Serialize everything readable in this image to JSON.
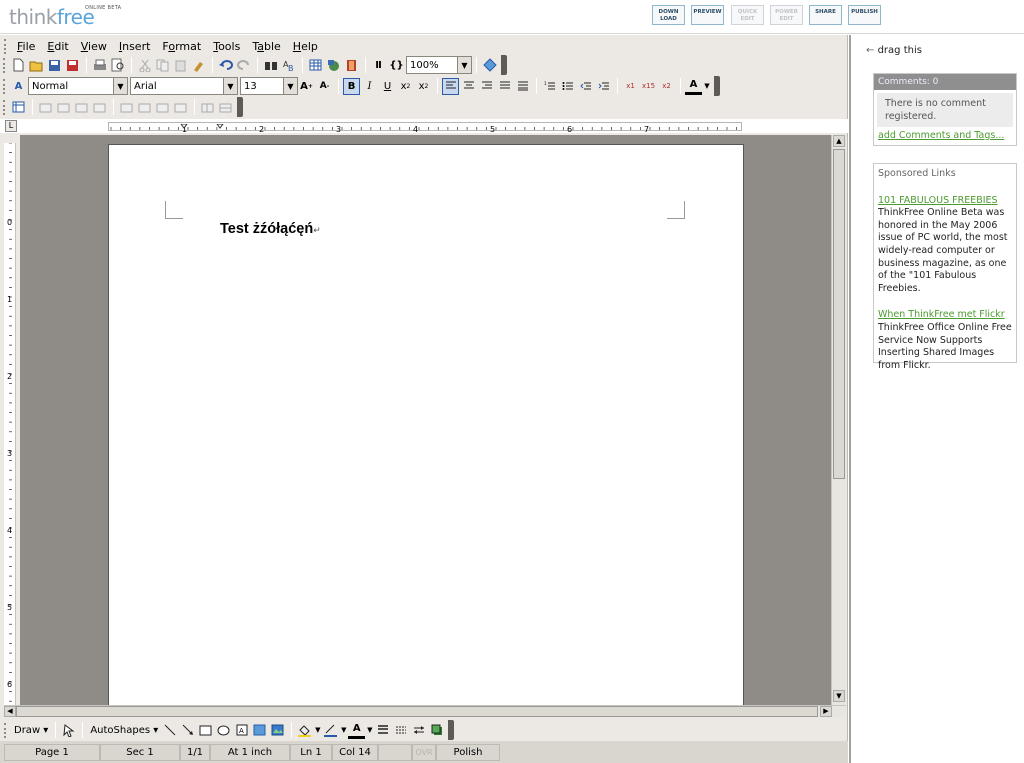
{
  "header": {
    "logo_think": "think",
    "logo_free": "free",
    "logo_beta": "ONLINE BETA",
    "buttons": [
      {
        "label": "DOWN\nLOAD",
        "enabled": true
      },
      {
        "label": "PREVIEW",
        "enabled": true
      },
      {
        "label": "QUICK\nEDIT",
        "enabled": false
      },
      {
        "label": "POWER\nEDIT",
        "enabled": false
      },
      {
        "label": "SHARE",
        "enabled": true
      },
      {
        "label": "PUBLISH",
        "enabled": true
      }
    ]
  },
  "menu": [
    "File",
    "Edit",
    "View",
    "Insert",
    "Format",
    "Tools",
    "Table",
    "Help"
  ],
  "menu_accel": [
    "F",
    "E",
    "V",
    "I",
    "o",
    "T",
    "a",
    "H"
  ],
  "toolbar": {
    "zoom": "100%",
    "style": "Normal",
    "font": "Arial",
    "size": "13"
  },
  "document": {
    "text": "Test żźółąćęń",
    "paragraph_mark": "↵"
  },
  "ruler": {
    "numbers": [
      "1",
      "2",
      "3",
      "4",
      "5",
      "6",
      "7"
    ],
    "vnumbers": [
      "0",
      "1",
      "2",
      "3",
      "4",
      "5",
      "6"
    ]
  },
  "drawbar": {
    "draw": "Draw",
    "autoshapes": "AutoShapes"
  },
  "status": {
    "page": "Page 1",
    "sec": "Sec 1",
    "pages": "1/1",
    "at": "At 1 inch",
    "ln": "Ln 1",
    "col": "Col 14",
    "ovr": "OVR",
    "language": "Polish"
  },
  "sidebar": {
    "drag": "drag this",
    "comments_header": "Comments: 0",
    "no_comment": "There is no comment registered.",
    "add_link": "add Comments and Tags...",
    "sponsored_title": "Sponsored Links",
    "ads": [
      {
        "title": "101 FABULOUS FREEBIES",
        "body": "ThinkFree Online Beta was honored in the May 2006 issue of PC world, the most widely-read computer or business magazine, as one of the \"101 Fabulous Freebies."
      },
      {
        "title": "When ThinkFree met Flickr",
        "body": "ThinkFree Office Online Free Service Now Supports Inserting Shared Images from Flickr."
      }
    ]
  },
  "colors": {
    "accent": "#5aa4dc",
    "link": "#4c9a30",
    "workspace": "#8f8c87",
    "chrome": "#ece9e4"
  }
}
